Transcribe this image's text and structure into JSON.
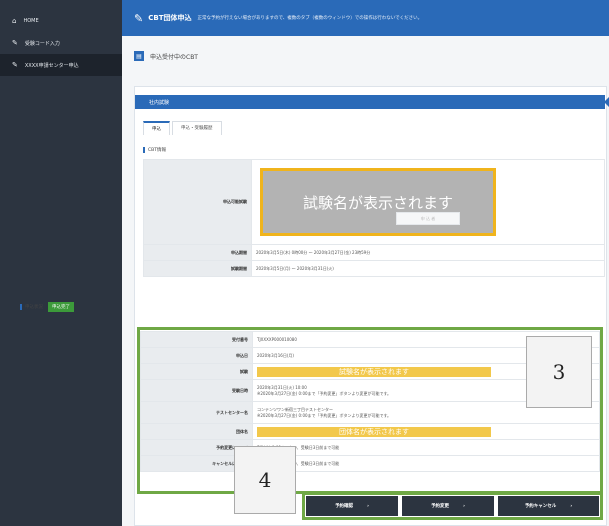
{
  "sidebar": {
    "items": [
      {
        "label": "HOME",
        "icon": "home-icon",
        "glyph": "⌂"
      },
      {
        "label": "受験コード入力",
        "icon": "pencil-icon",
        "glyph": "✎"
      },
      {
        "label": "XXXX申請センター申込",
        "icon": "pencil-icon",
        "glyph": "✎"
      }
    ]
  },
  "header": {
    "title": "CBT団体申込",
    "note": "正常な予約が行えない場合がありますので、複数のタブ（複数のウィンドウ）での操作は行わないでください。"
  },
  "subheader": {
    "title": "申込受付中のCBT"
  },
  "section": {
    "title": "社内試験"
  },
  "tabs": [
    "申込",
    "申込・受験履歴"
  ],
  "cbt_info": {
    "label": "CBT情報",
    "rows": {
      "exam_label": "申込可能試験",
      "exam_value": "試験名が表示されます",
      "period_label": "申込期間",
      "period_value": "2020年3月5日(木) 0時00分 〜 2020年3月27日(金) 23時59分",
      "test_label": "試験期間",
      "test_value": "2020年3月5日(月) 〜 2020年3月31日(火)"
    }
  },
  "apply_button": "申 込 者",
  "status": {
    "label": "申込状況",
    "badge": "申込完了"
  },
  "result": {
    "rows": [
      {
        "label": "受付番号",
        "value": "TJXXXXP000010080"
      },
      {
        "label": "申込日",
        "value": "2020年3月16日(月)"
      },
      {
        "label": "試験",
        "value": "試験名が表示されます"
      },
      {
        "label": "受験日時",
        "value": "2020年3月31日(火) 10:00",
        "sub": "※2020年3月27日(金) 0:00まで「予約変更」ボタンより変更が可能です。"
      },
      {
        "label": "テストセンター名",
        "value": "コンテンツワン新宿三丁目テストセンター",
        "sub": "※2020年3月27日(金) 0:00まで「予約変更」ボタンより変更が可能です。"
      },
      {
        "label": "団体名",
        "value": "団体名が表示されます"
      },
      {
        "label": "予約変更について",
        "value": "7日(金) 0:00までかつ、受験日3日前まで可能"
      },
      {
        "label": "キャンセルについて",
        "value": "7日(金) 0:00までかつ、受験日3日前まで可能"
      }
    ]
  },
  "callouts": {
    "three": "3",
    "four": "4"
  },
  "actions": {
    "confirm": "予約確認",
    "change": "予約変更",
    "cancel": "予約キャンセル",
    "arrow": "›"
  }
}
